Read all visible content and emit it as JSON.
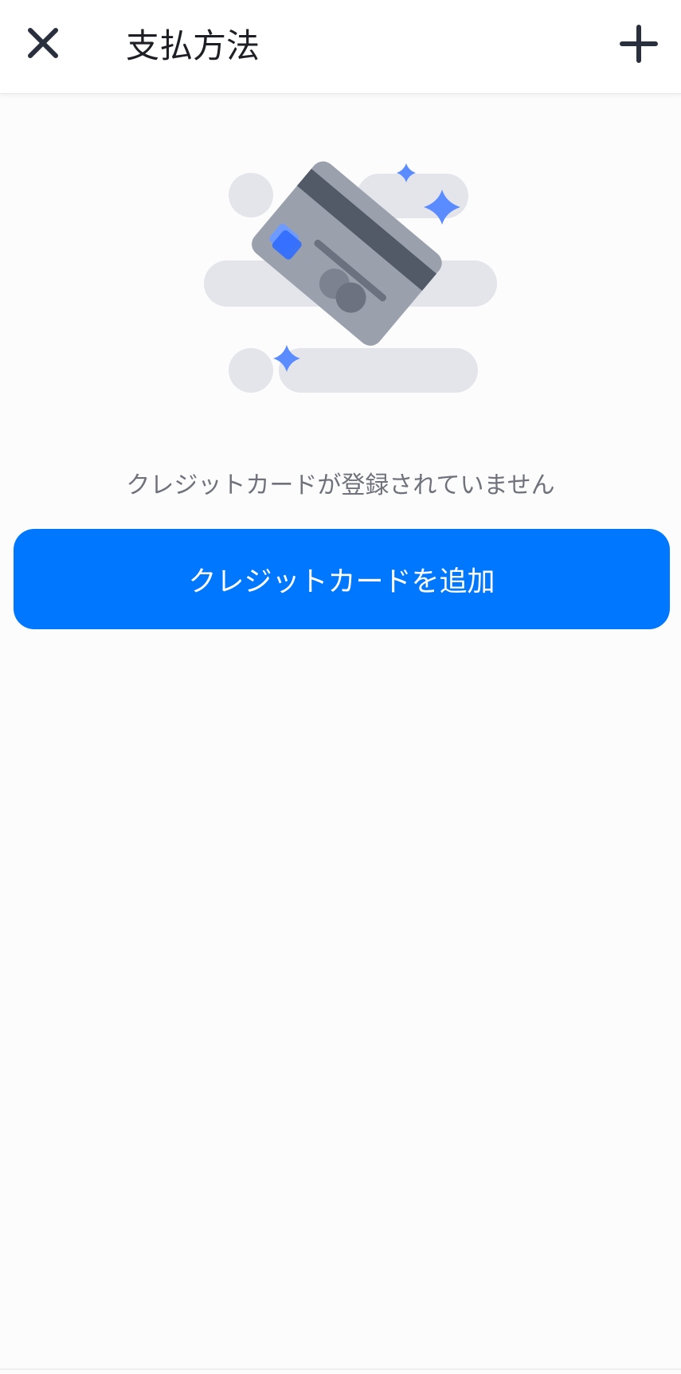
{
  "header": {
    "title": "支払方法",
    "close_icon": "close-icon",
    "add_icon": "plus-icon"
  },
  "empty_state": {
    "illustration": "credit-card-illustration",
    "message": "クレジットカードが登録されていません",
    "add_button_label": "クレジットカードを追加"
  },
  "colors": {
    "primary": "#0077ff",
    "icon_dark": "#2a2f3e",
    "text_secondary": "#6f727b",
    "card_gray": "#9aa1ad",
    "card_stripe": "#525a68",
    "cloud": "#e3e5eb",
    "sparkle": "#5b8cff"
  }
}
